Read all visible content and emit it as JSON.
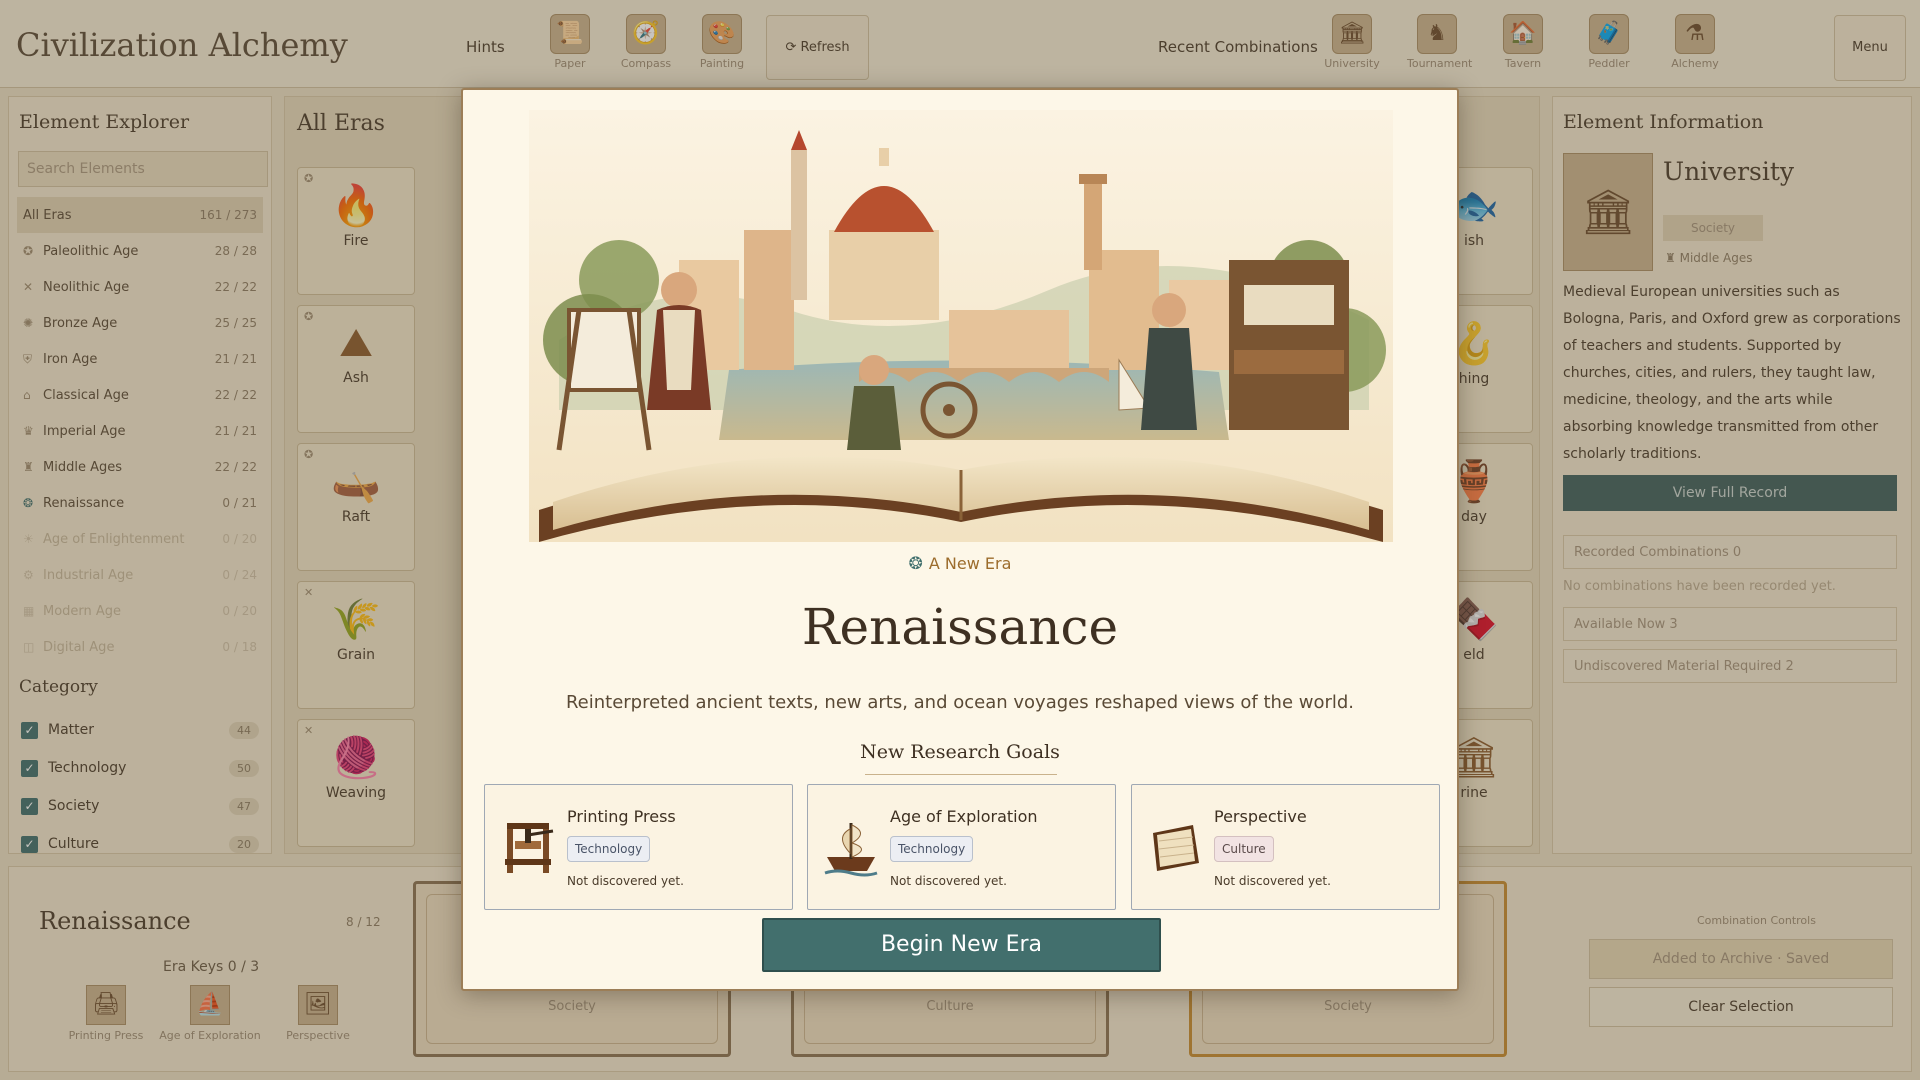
{
  "header": {
    "brand": "Civilization Alchemy",
    "hints_label": "Hints",
    "hint_tools": [
      {
        "label": "Paper",
        "icon": "scroll-icon"
      },
      {
        "label": "Compass",
        "icon": "compass-icon"
      },
      {
        "label": "Painting",
        "icon": "palette-icon"
      }
    ],
    "refresh_label": "⟳ Refresh",
    "recent_label": "Recent Combinations",
    "recent": [
      {
        "label": "University",
        "icon": "university-icon"
      },
      {
        "label": "Tournament",
        "icon": "knight-icon"
      },
      {
        "label": "Tavern",
        "icon": "tavern-icon"
      },
      {
        "label": "Peddler",
        "icon": "peddler-icon"
      },
      {
        "label": "Alchemy",
        "icon": "flask-icon"
      }
    ],
    "menu_label": "Menu"
  },
  "sidebar": {
    "title": "Element Explorer",
    "search_placeholder": "Search Elements",
    "eras": [
      {
        "label": "All Eras",
        "count": "161 / 273"
      },
      {
        "label": "Paleolithic Age",
        "count": "28 / 28"
      },
      {
        "label": "Neolithic Age",
        "count": "22 / 22"
      },
      {
        "label": "Bronze Age",
        "count": "25 / 25"
      },
      {
        "label": "Iron Age",
        "count": "21 / 21"
      },
      {
        "label": "Classical Age",
        "count": "22 / 22"
      },
      {
        "label": "Imperial Age",
        "count": "21 / 21"
      },
      {
        "label": "Middle Ages",
        "count": "22 / 22"
      },
      {
        "label": "Renaissance",
        "count": "0 / 21"
      },
      {
        "label": "Age of Enlightenment",
        "count": "0 / 20"
      },
      {
        "label": "Industrial Age",
        "count": "0 / 24"
      },
      {
        "label": "Modern Age",
        "count": "0 / 20"
      },
      {
        "label": "Digital Age",
        "count": "0 / 18"
      }
    ],
    "category_title": "Category",
    "categories": [
      {
        "label": "Matter",
        "count": "44"
      },
      {
        "label": "Technology",
        "count": "50"
      },
      {
        "label": "Society",
        "count": "47"
      },
      {
        "label": "Culture",
        "count": "20"
      }
    ]
  },
  "workspace": {
    "title": "All Eras",
    "tiles": [
      {
        "label": "Fire",
        "icon": "🔥"
      },
      {
        "label": "Ash",
        "icon": "⛰"
      },
      {
        "label": "Raft",
        "icon": "🛶"
      },
      {
        "label": "Grain",
        "icon": "🌾"
      },
      {
        "label": "Weaving",
        "icon": "🧶"
      }
    ],
    "right_tiles": [
      {
        "label": "ish",
        "icon": "🐟"
      },
      {
        "label": "hing",
        "icon": "🪝"
      },
      {
        "label": "day",
        "icon": "🏺"
      },
      {
        "label": "eld",
        "icon": "🍫"
      },
      {
        "label": "rine",
        "icon": "🏛"
      }
    ]
  },
  "info": {
    "title": "Element Information",
    "name": "University",
    "tag": "Society",
    "era": "Middle Ages",
    "description": "Medieval European universities such as Bologna, Paris, and Oxford grew as corporations of teachers and students. Supported by churches, cities, and rulers, they taught law, medicine, theology, and the arts while absorbing knowledge transmitted from other scholarly traditions.",
    "view_button": "View Full Record",
    "recorded": "Recorded Combinations  0",
    "recorded_note": "No combinations have been recorded yet.",
    "available": "Available Now  3",
    "undiscovered": "Undiscovered Material Required  2"
  },
  "bottom": {
    "era": "Renaissance",
    "count": "8 / 12",
    "keys_label": "Era Keys  0 / 3",
    "keys": [
      {
        "label": "Printing Press",
        "icon": "🖨"
      },
      {
        "label": "Age of Exploration",
        "icon": "⛵"
      },
      {
        "label": "Perspective",
        "icon": "🖼"
      }
    ],
    "slots": [
      {
        "label": "Society"
      },
      {
        "label": "Culture"
      },
      {
        "label": "Society"
      }
    ],
    "controls_label": "Combination Controls",
    "saved_button": "Added to Archive · Saved",
    "clear_button": "Clear Selection"
  },
  "modal": {
    "eyebrow": "A New Era",
    "title": "Renaissance",
    "subtitle": "Reinterpreted ancient texts, new arts, and ocean voyages reshaped views of the world.",
    "goals_title": "New Research Goals",
    "goals": [
      {
        "name": "Printing Press",
        "tag": "Technology",
        "status": "Not discovered yet.",
        "icon": "printing-press-icon"
      },
      {
        "name": "Age of Exploration",
        "tag": "Technology",
        "status": "Not discovered yet.",
        "icon": "ship-icon"
      },
      {
        "name": "Perspective",
        "tag": "Culture",
        "status": "Not discovered yet.",
        "icon": "canvas-icon"
      }
    ],
    "begin_button": "Begin New Era"
  },
  "colors": {
    "accent_teal": "#426f6d",
    "parchment": "#fdf7e8",
    "eyebrow": "#9c6c2c"
  }
}
